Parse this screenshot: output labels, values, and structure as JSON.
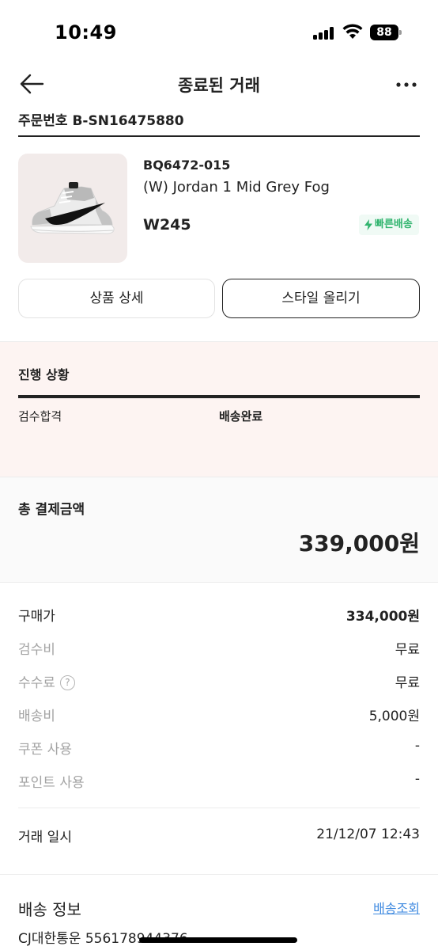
{
  "status_bar": {
    "time": "10:49",
    "battery": "88"
  },
  "header": {
    "title": "종료된 거래"
  },
  "order": {
    "label": "주문번호 B-SN16475880"
  },
  "product": {
    "model_no": "BQ6472-015",
    "name": "(W) Jordan 1 Mid Grey Fog",
    "size": "W245",
    "badge": "빠른배송"
  },
  "buttons": {
    "detail": "상품 상세",
    "style": "스타일 올리기"
  },
  "progress": {
    "title": "진행 상황",
    "steps": [
      "검수합격",
      "배송완료"
    ],
    "level": 1.0
  },
  "total": {
    "label": "총 결제금액",
    "value": "339,000원"
  },
  "fees": [
    {
      "label": "구매가",
      "value": "334,000원"
    },
    {
      "label": "검수비",
      "value": "무료"
    },
    {
      "label": "수수료",
      "value": "무료"
    },
    {
      "label": "배송비",
      "value": "5,000원"
    },
    {
      "label": "쿠폰 사용",
      "value": "-"
    },
    {
      "label": "포인트 사용",
      "value": "-"
    }
  ],
  "trade": {
    "label": "거래 일시",
    "value": "21/12/07 12:43"
  },
  "shipping": {
    "title": "배송 정보",
    "track": "배송조회",
    "carrier": "CJ대한통운 556178944376"
  },
  "colors": {
    "accent_green": "#31b46e",
    "link_blue": "#3f8ae0",
    "progress_bg": "#fdf4f2"
  }
}
